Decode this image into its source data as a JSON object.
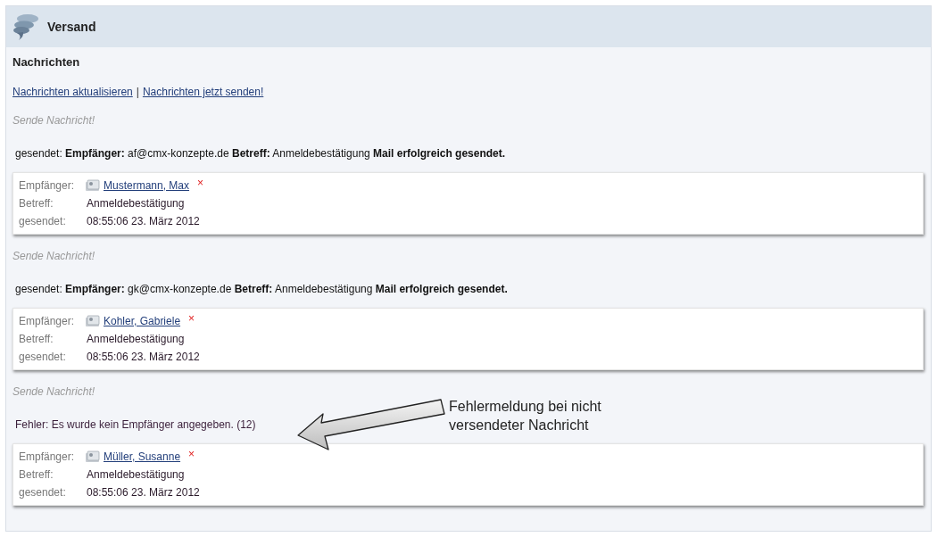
{
  "panel": {
    "title": "Versand"
  },
  "section": {
    "heading": "Nachrichten",
    "links": [
      "Nachrichten aktualisieren",
      "Nachrichten jetzt senden!"
    ],
    "separator": "|"
  },
  "messages": [
    {
      "notice": "Sende Nachricht!",
      "result": {
        "kind": "success",
        "text": "gesendet: **Empfänger:** af@cmx-konzepte.de **Betreff:** Anmeldebestätigung **Mail erfolgreich gesendet.**"
      },
      "card": {
        "recipient_label": "Empfänger:",
        "recipient": "Mustermann, Max",
        "remove": "×",
        "subject_label": "Betreff:",
        "subject": "Anmeldebestätigung",
        "sent_label": "gesendet:",
        "sent": "08:55:06 23. März 2012"
      }
    },
    {
      "notice": "Sende Nachricht!",
      "result": {
        "kind": "success",
        "text": "gesendet: **Empfänger:** gk@cmx-konzepte.de **Betreff:** Anmeldebestätigung **Mail erfolgreich gesendet.**"
      },
      "card": {
        "recipient_label": "Empfänger:",
        "recipient": "Kohler, Gabriele",
        "remove": "×",
        "subject_label": "Betreff:",
        "subject": "Anmeldebestätigung",
        "sent_label": "gesendet:",
        "sent": "08:55:06 23. März 2012"
      }
    },
    {
      "notice": "Sende Nachricht!",
      "result": {
        "kind": "error",
        "text": "Fehler: Es wurde kein Empfänger angegeben. (12)"
      },
      "card": {
        "recipient_label": "Empfänger:",
        "recipient": "Müller, Susanne",
        "remove": "×",
        "subject_label": "Betreff:",
        "subject": "Anmeldebestätigung",
        "sent_label": "gesendet:",
        "sent": "08:55:06 23. März 2012"
      }
    }
  ],
  "annotation": {
    "text": "Fehlermeldung bei nicht versendeter Nachricht"
  }
}
